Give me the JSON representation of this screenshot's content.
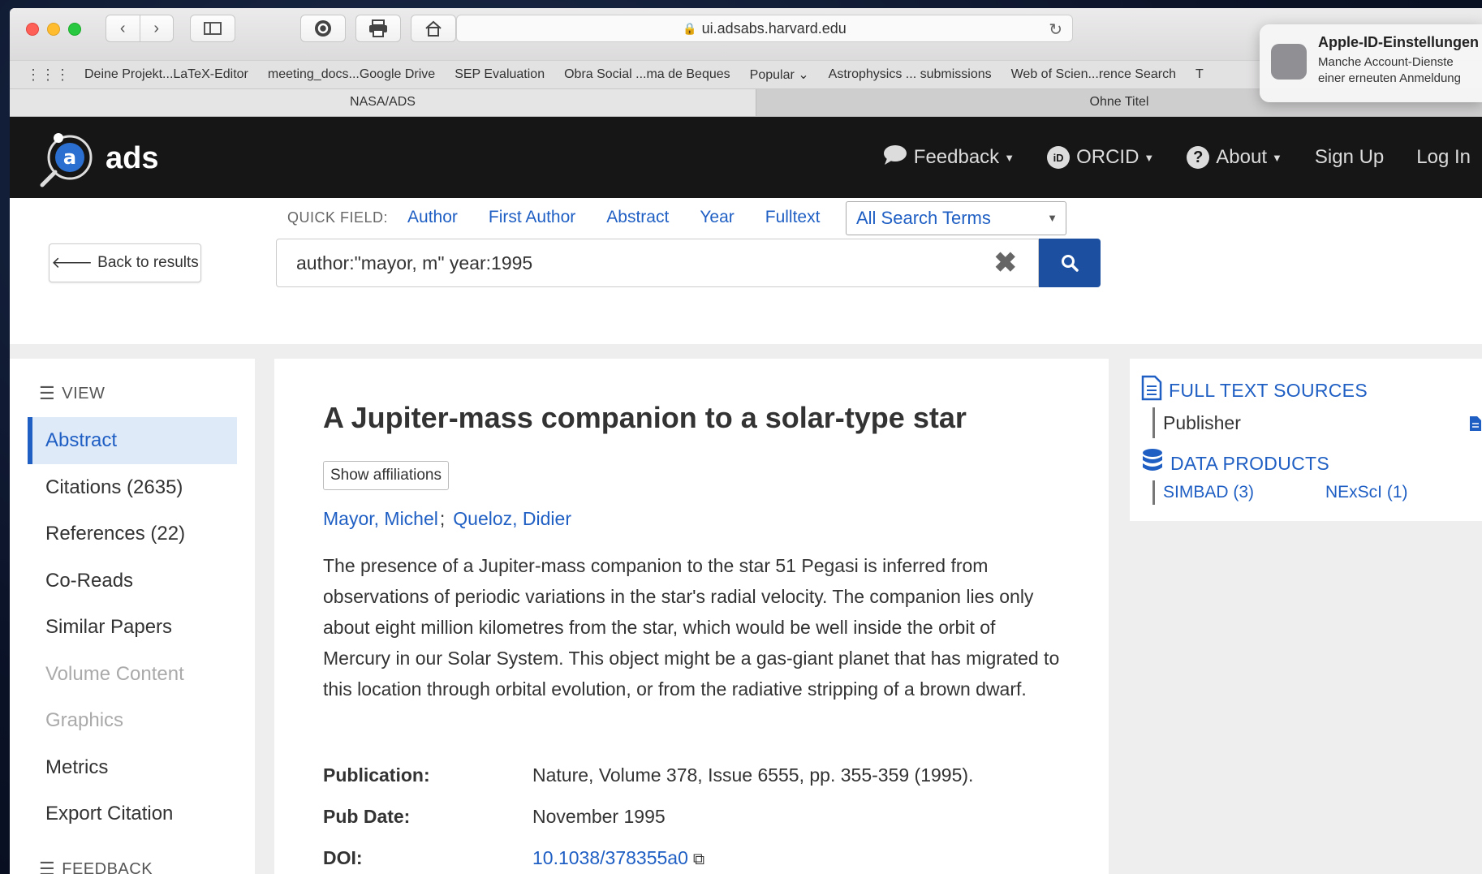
{
  "browser": {
    "address": "ui.adsabs.harvard.edu",
    "bookmarks": [
      "Deine Projekt...LaTeX-Editor",
      "meeting_docs...Google Drive",
      "SEP Evaluation",
      "Obra Social ...ma de Beques",
      "Popular ⌄",
      "Astrophysics ... submissions",
      "Web of Scien...rence Search",
      "T"
    ],
    "tabs": [
      "NASA/ADS",
      "Ohne Titel"
    ]
  },
  "notification": {
    "title": "Apple-ID-Einstellungen",
    "line1": "Manche Account-Dienste",
    "line2": "einer erneuten Anmeldung"
  },
  "ads": {
    "logo_text": "ads",
    "nav": {
      "feedback": "Feedback",
      "orcid": "ORCID",
      "about": "About",
      "signup": "Sign Up",
      "login": "Log In"
    }
  },
  "search": {
    "back_label": "Back to results",
    "quick_field_label": "QUICK FIELD:",
    "quick_fields": [
      "Author",
      "First Author",
      "Abstract",
      "Year",
      "Fulltext"
    ],
    "select_value": "All Search Terms",
    "query": "author:\"mayor, m\" year:1995"
  },
  "sidebar": {
    "view_heading": "VIEW",
    "items": [
      "Abstract",
      "Citations (2635)",
      "References (22)",
      "Co-Reads",
      "Similar Papers",
      "Volume Content",
      "Graphics",
      "Metrics",
      "Export Citation"
    ],
    "feedback_heading": "FEEDBACK"
  },
  "paper": {
    "title": "A Jupiter-mass companion to a solar-type star",
    "affiliations_button": "Show affiliations",
    "authors": [
      "Mayor, Michel",
      "Queloz, Didier"
    ],
    "author_sep": ";",
    "abstract": "The presence of a Jupiter-mass companion to the star 51 Pegasi is inferred from observations of periodic variations in the star's radial velocity. The companion lies only about eight million kilometres from the star, which would be well inside the orbit of Mercury in our Solar System. This object might be a gas-giant planet that has migrated to this location through orbital evolution, or from the radiative stripping of a brown dwarf.",
    "publication_label": "Publication:",
    "publication": "Nature, Volume 378, Issue 6555, pp. 355-359 (1995).",
    "pubdate_label": "Pub Date:",
    "pubdate": "November 1995",
    "doi_label": "DOI:",
    "doi": "10.1038/378355a0"
  },
  "right_panel": {
    "full_text_heading": "FULL TEXT SOURCES",
    "publisher": "Publisher",
    "data_products_heading": "DATA PRODUCTS",
    "simbad": "SIMBAD (3)",
    "nexsci": "NExScI (1)"
  },
  "colors": {
    "accent": "#1f5fc4",
    "nav_bg": "#161616",
    "search_button": "#1c4fa0"
  }
}
